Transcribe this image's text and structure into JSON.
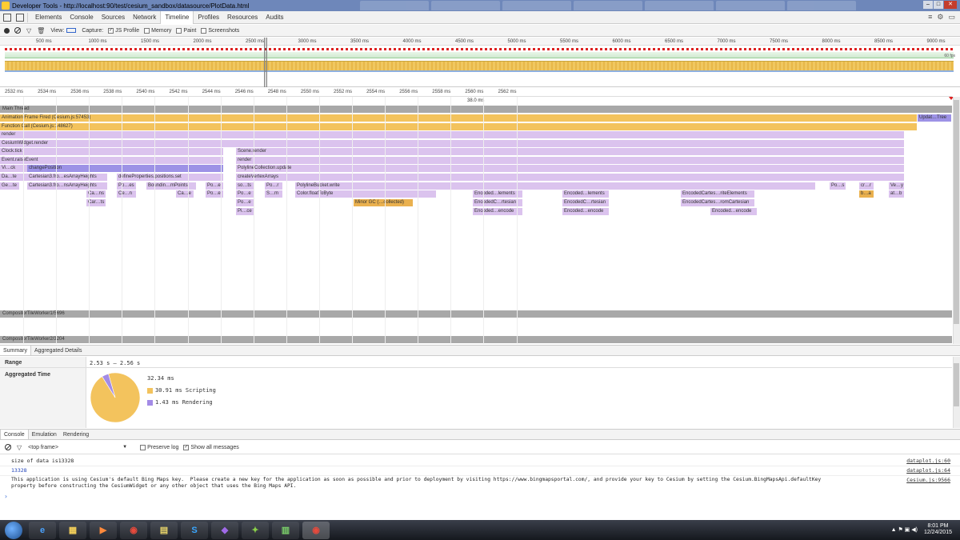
{
  "window": {
    "title": "Developer Tools - http://localhost:90/test/cesium_sandbox/datasource/PlotData.html",
    "controls": [
      "–",
      "□",
      "✕"
    ]
  },
  "panel_tabs": [
    "Elements",
    "Console",
    "Sources",
    "Network",
    "Timeline",
    "Profiles",
    "Resources",
    "Audits"
  ],
  "toolbar": {
    "view_label": "View:",
    "capture_label": "Capture:",
    "options": [
      {
        "label": "JS Profile",
        "checked": true
      },
      {
        "label": "Memory",
        "checked": false
      },
      {
        "label": "Paint",
        "checked": false
      },
      {
        "label": "Screenshots",
        "checked": false
      }
    ]
  },
  "overview": {
    "ticks": [
      "500 ms",
      "1000 ms",
      "1500 ms",
      "2000 ms",
      "2500 ms",
      "3000 ms",
      "3500 ms",
      "4000 ms",
      "4500 ms",
      "5000 ms",
      "5500 ms",
      "6000 ms",
      "6500 ms",
      "7000 ms",
      "7500 ms",
      "8000 ms",
      "8500 ms",
      "9000 ms"
    ],
    "fps_label": "60 fps"
  },
  "flame": {
    "ticks": [
      "2532 ms",
      "2534 ms",
      "2536 ms",
      "2538 ms",
      "2540 ms",
      "2542 ms",
      "2544 ms",
      "2546 ms",
      "2548 ms",
      "2550 ms",
      "2552 ms",
      "2554 ms",
      "2556 ms",
      "2558 ms",
      "2560 ms",
      "2562 ms"
    ],
    "duration": "38.0 ms",
    "main_thread": "Main Thread",
    "worker1": "CompositorTileWorker1/5696",
    "worker2": "CompositorTileWorker2/3204",
    "bars": [
      {
        "label": "Animation Frame Fired (Cesium.js:57453)",
        "c": "y"
      },
      {
        "label": "Updat…Tree",
        "c": "pd"
      },
      {
        "label": "Function Call (Cesium.js:148627)",
        "c": "y"
      },
      {
        "label": "render",
        "c": "p"
      },
      {
        "label": "CesiumWidget.render",
        "c": "p"
      },
      {
        "label": "Clock.tick",
        "c": "p"
      },
      {
        "label": "Scene.render",
        "c": "p"
      },
      {
        "label": "Event.raiseEvent",
        "c": "p"
      },
      {
        "label": "render",
        "c": "p"
      },
      {
        "label": "Vi…ck",
        "c": "p"
      },
      {
        "label": "changePosition",
        "c": "pd"
      },
      {
        "label": "PolylineCollection.update",
        "c": "p"
      },
      {
        "label": "Da…te",
        "c": "p"
      },
      {
        "label": "Cartesian3.fro…esArrayHeights",
        "c": "p"
      },
      {
        "label": "defineProperties.positions.set",
        "c": "p"
      },
      {
        "label": "createVertexArrays",
        "c": "p"
      },
      {
        "label": "Ge…te",
        "c": "p"
      },
      {
        "label": "Cartesian3.fro…nsArrayHeights",
        "c": "p"
      },
      {
        "label": "Po…es",
        "c": "p"
      },
      {
        "label": "Boundin…mPoints",
        "c": "p"
      },
      {
        "label": "Po…e",
        "c": "p"
      },
      {
        "label": "so…ts",
        "c": "p"
      },
      {
        "label": "Po…r",
        "c": "p"
      },
      {
        "label": "PolylineBucket.write",
        "c": "p"
      },
      {
        "label": "Po…s",
        "c": "p"
      },
      {
        "label": "cr…r",
        "c": "p"
      },
      {
        "label": "Ve…y",
        "c": "p"
      },
      {
        "label": "Ca…ns",
        "c": "p"
      },
      {
        "label": "Ce…n",
        "c": "p"
      },
      {
        "label": "Ca…e",
        "c": "p"
      },
      {
        "label": "Po…e",
        "c": "p"
      },
      {
        "label": "Po…e",
        "c": "p"
      },
      {
        "label": "S…m",
        "c": "p"
      },
      {
        "label": "Color.floatToByte",
        "c": "p"
      },
      {
        "label": "Encoded…lements",
        "c": "p"
      },
      {
        "label": "Encoded…lements",
        "c": "p"
      },
      {
        "label": "EncodedCartes…riteElements",
        "c": "p"
      },
      {
        "label": "b…a",
        "c": "o"
      },
      {
        "label": "at…b",
        "c": "p"
      },
      {
        "label": "Car…ts",
        "c": "p"
      },
      {
        "label": "Po…e",
        "c": "p"
      },
      {
        "label": "Minor GC (…collected)",
        "c": "o"
      },
      {
        "label": "EncodedC…rtesian",
        "c": "p"
      },
      {
        "label": "EncodedC…rtesian",
        "c": "p"
      },
      {
        "label": "EncodedCartes…romCartesian",
        "c": "p"
      },
      {
        "label": "Pi…ce",
        "c": "p"
      },
      {
        "label": "Encoded…encode",
        "c": "p"
      },
      {
        "label": "Encoded…encode",
        "c": "p"
      },
      {
        "label": "Encoded…encode",
        "c": "p"
      }
    ]
  },
  "summary": {
    "tabs": [
      "Summary",
      "Aggregated Details"
    ],
    "range_label": "Range",
    "range_value": "2.53 s – 2.56 s",
    "agg_label": "Aggregated Time",
    "total": "32.34 ms",
    "items": [
      {
        "label": "30.91 ms Scripting",
        "color": "#f3c35d",
        "value": 30.91
      },
      {
        "label": "1.43 ms Rendering",
        "color": "#a38be6",
        "value": 1.43
      }
    ]
  },
  "drawer": {
    "tabs": [
      "Console",
      "Emulation",
      "Rendering"
    ],
    "frame": "<top frame>",
    "preserve_log": "Preserve log",
    "show_all": "Show all messages"
  },
  "console": {
    "messages": [
      {
        "text": "size of data is13328",
        "src": "dataplot.js:60",
        "color": "#222"
      },
      {
        "text": "13328",
        "src": "dataplot.js:64",
        "color": "#1c3fb8"
      },
      {
        "text": "This application is using Cesium's default Bing Maps key.  Please create a new key for the application as soon as possible and prior to deployment by visiting https://www.bingmapsportal.com/, and provide your key to Cesium by setting the Cesium.BingMapsApi.defaultKey",
        "src": "Cesium.js:9566",
        "color": "#222"
      },
      {
        "text": "property before constructing the CesiumWidget or any other object that uses the Bing Maps API.",
        "src": "",
        "color": "#222"
      }
    ],
    "prompt": "›"
  },
  "taskbar": {
    "apps": [
      "e",
      "▦",
      "▶",
      "◉",
      "▤",
      "S",
      "◆",
      "✦",
      "▥",
      "◉"
    ],
    "time": "8:01 PM",
    "date": "12/24/2015"
  }
}
